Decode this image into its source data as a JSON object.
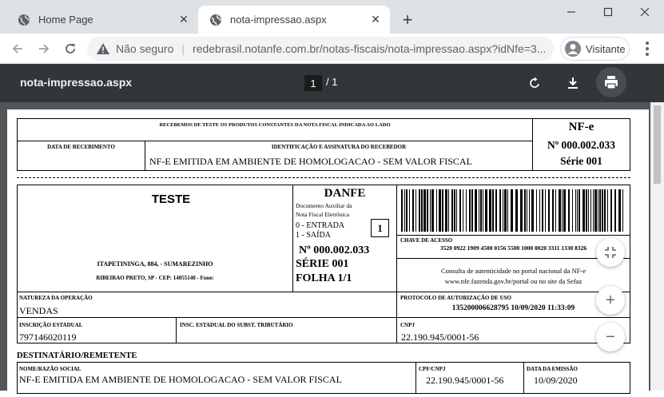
{
  "browser": {
    "tabs": [
      {
        "label": "Home Page",
        "active": false
      },
      {
        "label": "nota-impressao.aspx",
        "active": true
      }
    ],
    "omnibox": {
      "security": "Não seguro",
      "url": "redebrasil.notanfe.com.br/notas-fiscais/nota-impressao.aspx?idNfe=3..."
    },
    "profile_label": "Visitante"
  },
  "pdf_viewer": {
    "title": "nota-impressao.aspx",
    "current_page": "1",
    "total_pages": "/  1"
  },
  "document": {
    "receipt": {
      "header": "RECEBEMOS DE TESTE OS PRODUTOS CONSTANTES DA NOTA FISCAL INDICADA AO LADO",
      "date_label": "DATA DE RECEBIMENTO",
      "sig_label": "IDENTIFICAÇÃO E ASSINATURA DO RECEBEDOR",
      "sig_value": "NF-E EMITIDA EM AMBIENTE DE HOMOLOGACAO - SEM VALOR FISCAL",
      "nfe": "NF-e",
      "number": "Nº 000.002.033",
      "serie": "Série 001"
    },
    "issuer": {
      "name": "TESTE",
      "address1": "ITAPETININGA, 884,  - SUMAREZINHO",
      "address2": "RIBEIRAO PRETO, SP - CEP: 14055140 - Fone:"
    },
    "danfe": {
      "title": "DANFE",
      "sub1": "Documento Auxiliar da",
      "sub2": "Nota Fiscal Eletrônica",
      "entrada": "0 - ENTRADA",
      "saida": "1 - SAÍDA",
      "type_value": "1",
      "number": "Nº 000.002.033",
      "serie": "SÉRIE 001",
      "folha": "FOLHA 1/1"
    },
    "access": {
      "label": "CHAVE DE ACESSO",
      "key": "3520 0922 1909 4500 0156 5500 1000 0020 3311 1330 8326",
      "consult1": "Consulta de autenticidade no portal nacional da NF-e",
      "consult2": "www.nfe.fazenda.gov.br/portal ou no site da Sefaz"
    },
    "nature": {
      "label": "NATUREZA DA OPERAÇÃO",
      "value": "VENDAS"
    },
    "protocol": {
      "label": "PROTOCOLO DE AUTORIZAÇÃO DE USO",
      "value": "135200006628795 10/09/2020 11:33:09"
    },
    "ie": {
      "label": "INSCRIÇÃO ESTADUAL",
      "value": "797146020119"
    },
    "ie_st": {
      "label": "INSC. ESTADUAL DO SUBST. TRIBUTÁRIO",
      "value": ""
    },
    "cnpj": {
      "label": "CNPJ",
      "value": "22.190.945/0001-56"
    },
    "recipient": {
      "section_title": "DESTINATÁRIO/REMETENTE",
      "name_label": "NOME/RAZÃO SOCIAL",
      "name_value": "NF-E EMITIDA EM AMBIENTE DE HOMOLOGACAO - SEM VALOR FISCAL",
      "cpf_label": "CPF/CNPJ",
      "cpf_value": "22.190.945/0001-56",
      "date_label": "DATA DA EMISSÃO",
      "date_value": "10/09/2020"
    }
  },
  "colors": {
    "tabbar": "#dee1e6",
    "pdf_toolbar": "#323639",
    "viewer_bg": "#525659"
  }
}
